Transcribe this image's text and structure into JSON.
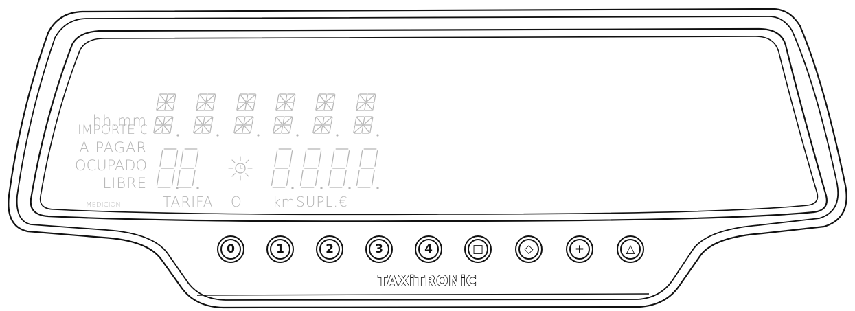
{
  "labels": {
    "hhmm": "hh.mm",
    "importe": "IMPORTE €",
    "a_pagar": "A PAGAR",
    "ocupado": "OCUPADO",
    "libre": "LIBRE",
    "medicion": "MEDICIÓN",
    "tarifa": "TARIFA",
    "o": "O",
    "km": "km",
    "supl": "SUPL.€"
  },
  "buttons": [
    {
      "name": "button-0",
      "symbol": "0"
    },
    {
      "name": "button-1",
      "symbol": "1"
    },
    {
      "name": "button-2",
      "symbol": "2"
    },
    {
      "name": "button-3",
      "symbol": "3"
    },
    {
      "name": "button-4",
      "symbol": "4"
    },
    {
      "name": "button-square",
      "symbol": "□"
    },
    {
      "name": "button-diamond",
      "symbol": "◇"
    },
    {
      "name": "button-plus",
      "symbol": "+"
    },
    {
      "name": "button-triangle",
      "symbol": "△"
    }
  ],
  "brand": "TAXiTRONiC",
  "colors": {
    "outline": "#111111",
    "lcd_segment": "#b5b5b5"
  }
}
